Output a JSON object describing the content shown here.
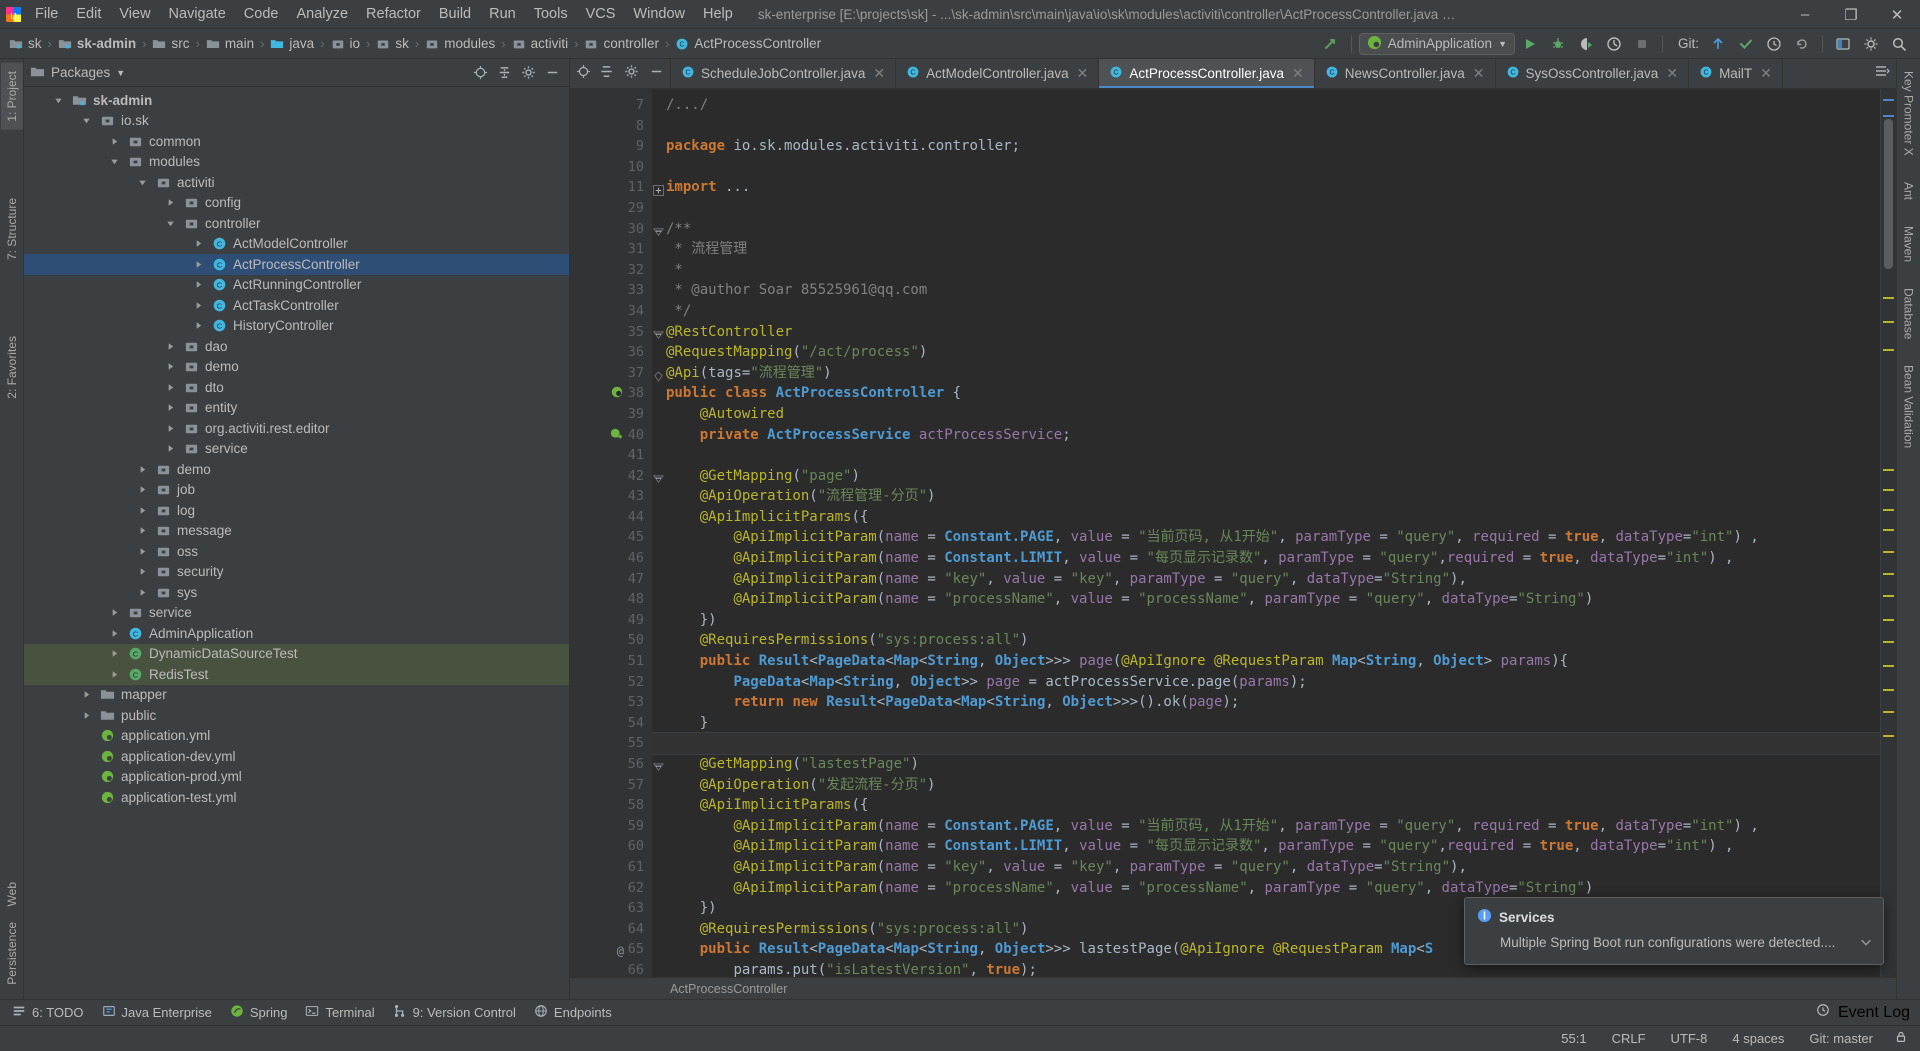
{
  "titlebar": {
    "menus": [
      "File",
      "Edit",
      "View",
      "Navigate",
      "Code",
      "Analyze",
      "Refactor",
      "Build",
      "Run",
      "Tools",
      "VCS",
      "Window",
      "Help"
    ],
    "project_title": "sk-enterprise [E:\\projects\\sk] - ...\\sk-admin\\src\\main\\java\\io\\sk\\modules\\activiti\\controller\\ActProcessController.java [sk-admin]",
    "minimize": "–",
    "maximize": "❐",
    "close": "✕"
  },
  "navbar": {
    "breadcrumbs": [
      {
        "label": "sk",
        "icon": "module-icon",
        "bold": false
      },
      {
        "label": "sk-admin",
        "icon": "module-icon",
        "bold": true
      },
      {
        "label": "src",
        "icon": "folder-icon",
        "bold": false
      },
      {
        "label": "main",
        "icon": "folder-icon",
        "bold": false
      },
      {
        "label": "java",
        "icon": "source-folder-icon",
        "bold": false
      },
      {
        "label": "io",
        "icon": "package-icon",
        "bold": false
      },
      {
        "label": "sk",
        "icon": "package-icon",
        "bold": false
      },
      {
        "label": "modules",
        "icon": "package-icon",
        "bold": false
      },
      {
        "label": "activiti",
        "icon": "package-icon",
        "bold": false
      },
      {
        "label": "controller",
        "icon": "package-icon",
        "bold": false
      },
      {
        "label": "ActProcessController",
        "icon": "class-icon",
        "bold": false
      }
    ],
    "separator": "›",
    "run_config": "AdminApplication",
    "git_label": "Git:",
    "accent": "#4a88c7"
  },
  "left_strip": {
    "tabs": [
      {
        "label": "1: Project",
        "active": true
      },
      {
        "label": "7: Structure",
        "active": false
      },
      {
        "label": "2: Favorites",
        "active": false
      },
      {
        "label": "Web",
        "active": false
      },
      {
        "label": "Persistence",
        "active": false
      }
    ]
  },
  "right_strip": {
    "tabs": [
      {
        "label": "Key Promoter X"
      },
      {
        "label": "Ant"
      },
      {
        "label": "Maven"
      },
      {
        "label": "Database"
      },
      {
        "label": "Bean Validation"
      }
    ]
  },
  "project_panel": {
    "title": "Packages",
    "tree": [
      {
        "indent": 0,
        "arrow": "down",
        "icon": "module-icon",
        "label": "sk-admin",
        "bold": true,
        "state": "none"
      },
      {
        "indent": 1,
        "arrow": "down",
        "icon": "package-icon",
        "label": "io.sk",
        "bold": false,
        "state": "none"
      },
      {
        "indent": 2,
        "arrow": "right",
        "icon": "package-icon",
        "label": "common",
        "bold": false,
        "state": "none"
      },
      {
        "indent": 2,
        "arrow": "down",
        "icon": "package-icon",
        "label": "modules",
        "bold": false,
        "state": "none"
      },
      {
        "indent": 3,
        "arrow": "down",
        "icon": "package-icon",
        "label": "activiti",
        "bold": false,
        "state": "none"
      },
      {
        "indent": 4,
        "arrow": "right",
        "icon": "package-icon",
        "label": "config",
        "bold": false,
        "state": "none"
      },
      {
        "indent": 4,
        "arrow": "down",
        "icon": "package-icon",
        "label": "controller",
        "bold": false,
        "state": "none"
      },
      {
        "indent": 5,
        "arrow": "right",
        "icon": "class-icon",
        "label": "ActModelController",
        "bold": false,
        "state": "none"
      },
      {
        "indent": 5,
        "arrow": "right",
        "icon": "class-icon",
        "label": "ActProcessController",
        "bold": false,
        "state": "selected"
      },
      {
        "indent": 5,
        "arrow": "right",
        "icon": "class-icon",
        "label": "ActRunningController",
        "bold": false,
        "state": "none"
      },
      {
        "indent": 5,
        "arrow": "right",
        "icon": "class-icon",
        "label": "ActTaskController",
        "bold": false,
        "state": "none"
      },
      {
        "indent": 5,
        "arrow": "right",
        "icon": "class-icon",
        "label": "HistoryController",
        "bold": false,
        "state": "none"
      },
      {
        "indent": 4,
        "arrow": "right",
        "icon": "package-icon",
        "label": "dao",
        "bold": false,
        "state": "none"
      },
      {
        "indent": 4,
        "arrow": "right",
        "icon": "package-icon",
        "label": "demo",
        "bold": false,
        "state": "none"
      },
      {
        "indent": 4,
        "arrow": "right",
        "icon": "package-icon",
        "label": "dto",
        "bold": false,
        "state": "none"
      },
      {
        "indent": 4,
        "arrow": "right",
        "icon": "package-icon",
        "label": "entity",
        "bold": false,
        "state": "none"
      },
      {
        "indent": 4,
        "arrow": "right",
        "icon": "package-icon",
        "label": "org.activiti.rest.editor",
        "bold": false,
        "state": "none"
      },
      {
        "indent": 4,
        "arrow": "right",
        "icon": "package-icon",
        "label": "service",
        "bold": false,
        "state": "none"
      },
      {
        "indent": 3,
        "arrow": "right",
        "icon": "package-icon",
        "label": "demo",
        "bold": false,
        "state": "none"
      },
      {
        "indent": 3,
        "arrow": "right",
        "icon": "package-icon",
        "label": "job",
        "bold": false,
        "state": "none"
      },
      {
        "indent": 3,
        "arrow": "right",
        "icon": "package-icon",
        "label": "log",
        "bold": false,
        "state": "none"
      },
      {
        "indent": 3,
        "arrow": "right",
        "icon": "package-icon",
        "label": "message",
        "bold": false,
        "state": "none"
      },
      {
        "indent": 3,
        "arrow": "right",
        "icon": "package-icon",
        "label": "oss",
        "bold": false,
        "state": "none"
      },
      {
        "indent": 3,
        "arrow": "right",
        "icon": "package-icon",
        "label": "security",
        "bold": false,
        "state": "none"
      },
      {
        "indent": 3,
        "arrow": "right",
        "icon": "package-icon",
        "label": "sys",
        "bold": false,
        "state": "none"
      },
      {
        "indent": 2,
        "arrow": "right",
        "icon": "package-icon",
        "label": "service",
        "bold": false,
        "state": "none"
      },
      {
        "indent": 2,
        "arrow": "right",
        "icon": "class-icon",
        "label": "AdminApplication",
        "bold": false,
        "state": "none"
      },
      {
        "indent": 2,
        "arrow": "right",
        "icon": "test-icon",
        "label": "DynamicDataSourceTest",
        "bold": false,
        "state": "green"
      },
      {
        "indent": 2,
        "arrow": "right",
        "icon": "test-icon",
        "label": "RedisTest",
        "bold": false,
        "state": "green"
      },
      {
        "indent": 1,
        "arrow": "right",
        "icon": "folder-icon",
        "label": "mapper",
        "bold": false,
        "state": "none"
      },
      {
        "indent": 1,
        "arrow": "right",
        "icon": "folder-icon",
        "label": "public",
        "bold": false,
        "state": "none"
      },
      {
        "indent": 1,
        "arrow": "none",
        "icon": "yml-icon",
        "label": "application.yml",
        "bold": false,
        "state": "none"
      },
      {
        "indent": 1,
        "arrow": "none",
        "icon": "yml-icon",
        "label": "application-dev.yml",
        "bold": false,
        "state": "none"
      },
      {
        "indent": 1,
        "arrow": "none",
        "icon": "yml-icon",
        "label": "application-prod.yml",
        "bold": false,
        "state": "none"
      },
      {
        "indent": 1,
        "arrow": "none",
        "icon": "yml-icon",
        "label": "application-test.yml",
        "bold": false,
        "state": "none"
      }
    ]
  },
  "editor": {
    "tabs": [
      {
        "label": "ScheduleJobController.java",
        "active": false
      },
      {
        "label": "ActModelController.java",
        "active": false
      },
      {
        "label": "ActProcessController.java",
        "active": true
      },
      {
        "label": "NewsController.java",
        "active": false
      },
      {
        "label": "SysOssController.java",
        "active": false
      },
      {
        "label": "MailT",
        "active": false
      }
    ],
    "close_glyph": "✕",
    "breadcrumb": "ActProcessController",
    "line_numbers": [
      7,
      8,
      9,
      10,
      11,
      29,
      30,
      31,
      32,
      33,
      34,
      35,
      36,
      37,
      38,
      39,
      40,
      41,
      42,
      43,
      44,
      45,
      46,
      47,
      48,
      49,
      50,
      51,
      52,
      53,
      54,
      55,
      56,
      57,
      58,
      59,
      60,
      61,
      62,
      63,
      64,
      65,
      66
    ],
    "highlighted_line": 55,
    "code": [
      "/.../",
      "",
      "package io.sk.modules.activiti.controller;",
      "",
      "import ...",
      "",
      "/**",
      " * 流程管理",
      " *",
      " * @author Soar 85525961@qq.com",
      " */",
      "@RestController",
      "@RequestMapping(\"/act/process\")",
      "@Api(tags=\"流程管理\")",
      "public class ActProcessController {",
      "    @Autowired",
      "    private ActProcessService actProcessService;",
      "",
      "    @GetMapping(\"page\")",
      "    @ApiOperation(\"流程管理-分页\")",
      "    @ApiImplicitParams({",
      "        @ApiImplicitParam(name = Constant.PAGE, value = \"当前页码, 从1开始\", paramType = \"query\", required = true, dataType=\"int\") ,",
      "        @ApiImplicitParam(name = Constant.LIMIT, value = \"每页显示记录数\", paramType = \"query\",required = true, dataType=\"int\") ,",
      "        @ApiImplicitParam(name = \"key\", value = \"key\", paramType = \"query\", dataType=\"String\"),",
      "        @ApiImplicitParam(name = \"processName\", value = \"processName\", paramType = \"query\", dataType=\"String\")",
      "    })",
      "    @RequiresPermissions(\"sys:process:all\")",
      "    public Result<PageData<Map<String, Object>>> page(@ApiIgnore @RequestParam Map<String, Object> params){",
      "        PageData<Map<String, Object>> page = actProcessService.page(params);",
      "        return new Result<PageData<Map<String, Object>>>().ok(page);",
      "    }",
      "",
      "    @GetMapping(\"lastestPage\")",
      "    @ApiOperation(\"发起流程-分页\")",
      "    @ApiImplicitParams({",
      "        @ApiImplicitParam(name = Constant.PAGE, value = \"当前页码, 从1开始\", paramType = \"query\", required = true, dataType=\"int\") ,",
      "        @ApiImplicitParam(name = Constant.LIMIT, value = \"每页显示记录数\", paramType = \"query\",required = true, dataType=\"int\") ,",
      "        @ApiImplicitParam(name = \"key\", value = \"key\", paramType = \"query\", dataType=\"String\"),",
      "        @ApiImplicitParam(name = \"processName\", value = \"processName\", paramType = \"query\", dataType=\"String\")",
      "    })",
      "    @RequiresPermissions(\"sys:process:all\")",
      "    public Result<PageData<Map<String, Object>>> lastestPage(@ApiIgnore @RequestParam Map<S",
      "        params.put(\"isLatestVersion\", true);"
    ]
  },
  "services_popup": {
    "title": "Services",
    "message": "Multiple Spring Boot run configurations were detected....",
    "info_color": "#589df6"
  },
  "bottom_bar": {
    "items": [
      {
        "label": "6: TODO",
        "icon": "todo-icon"
      },
      {
        "label": "Java Enterprise",
        "icon": "java-ee-icon"
      },
      {
        "label": "Spring",
        "icon": "spring-icon"
      },
      {
        "label": "Terminal",
        "icon": "terminal-icon"
      },
      {
        "label": "9: Version Control",
        "icon": "vcs-icon"
      },
      {
        "label": "Endpoints",
        "icon": "endpoints-icon"
      }
    ],
    "event_log": "Event Log"
  },
  "status_bar": {
    "caret": "55:1",
    "line_sep": "CRLF",
    "encoding": "UTF-8",
    "indent": "4 spaces",
    "branch": "Git: master"
  }
}
